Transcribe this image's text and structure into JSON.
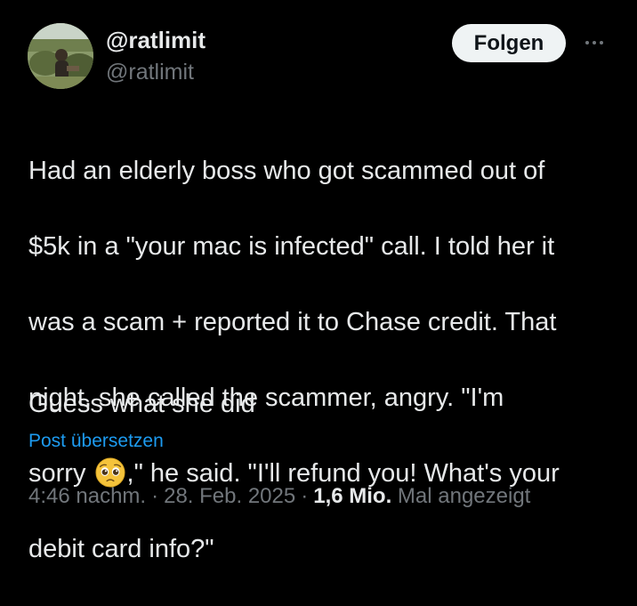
{
  "author": {
    "display_name": "@ratlimit",
    "handle": "@ratlimit"
  },
  "actions": {
    "follow_label": "Folgen"
  },
  "tweet": {
    "lines": [
      "Had an elderly boss who got scammed out of",
      "$5k in a \"your mac is infected\" call. I told her it",
      "was a scam + reported it to Chase credit. That",
      "night, she called the scammer, angry. \"I'm",
      "sorry",
      ",\" he said. \"I'll refund you! What's your",
      "debit card info?\""
    ],
    "emoji": "pleading-face-emoji",
    "closing": "Guess what she did",
    "translate_label": "Post übersetzen"
  },
  "meta": {
    "time": "4:46 nachm.",
    "separator": "·",
    "date": "28. Feb. 2025",
    "views_count": "1,6 Mio.",
    "views_label": "Mal angezeigt"
  },
  "colors": {
    "background": "#000000",
    "text": "#e7e9ea",
    "muted": "#71767b",
    "link": "#1d9bf0",
    "button_bg": "#eff3f4"
  }
}
